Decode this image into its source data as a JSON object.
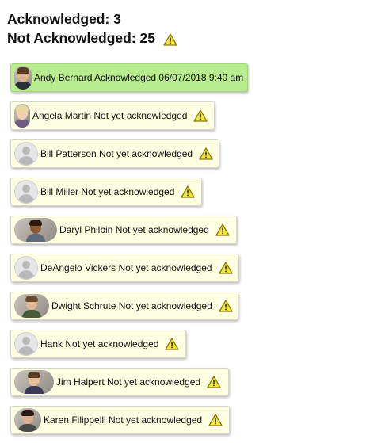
{
  "summary": {
    "acknowledged": "Acknowledged: 3",
    "not_acknowledged": "Not Acknowledged: 25",
    "warning_icon": "warning-triangle-icon"
  },
  "colors": {
    "acknowledged_bg": "#b9ec8f",
    "pending_bg": "#ffffe3",
    "warning_fill": "#f4e53a",
    "warning_stroke": "#8a7a10"
  },
  "people": [
    {
      "text": "Andy Bernard Acknowledged 06/07/2018 9:40 am",
      "status": "acknowledged",
      "avatar": "photo"
    },
    {
      "text": "Angela Martin Not yet acknowledged",
      "status": "pending",
      "avatar": "photo"
    },
    {
      "text": "Bill Patterson Not yet acknowledged",
      "status": "pending",
      "avatar": "generic"
    },
    {
      "text": "Bill Miller Not yet acknowledged",
      "status": "pending",
      "avatar": "generic"
    },
    {
      "text": "Daryl Philbin Not yet acknowledged",
      "status": "pending",
      "avatar": "photo"
    },
    {
      "text": "DeAngelo Vickers Not yet acknowledged",
      "status": "pending",
      "avatar": "generic"
    },
    {
      "text": "Dwight Schrute Not yet acknowledged",
      "status": "pending",
      "avatar": "photo"
    },
    {
      "text": "Hank Not yet acknowledged",
      "status": "pending",
      "avatar": "generic"
    },
    {
      "text": "Jim Halpert Not yet acknowledged",
      "status": "pending",
      "avatar": "photo"
    },
    {
      "text": "Karen Filippelli Not yet acknowledged",
      "status": "pending",
      "avatar": "photo"
    }
  ]
}
